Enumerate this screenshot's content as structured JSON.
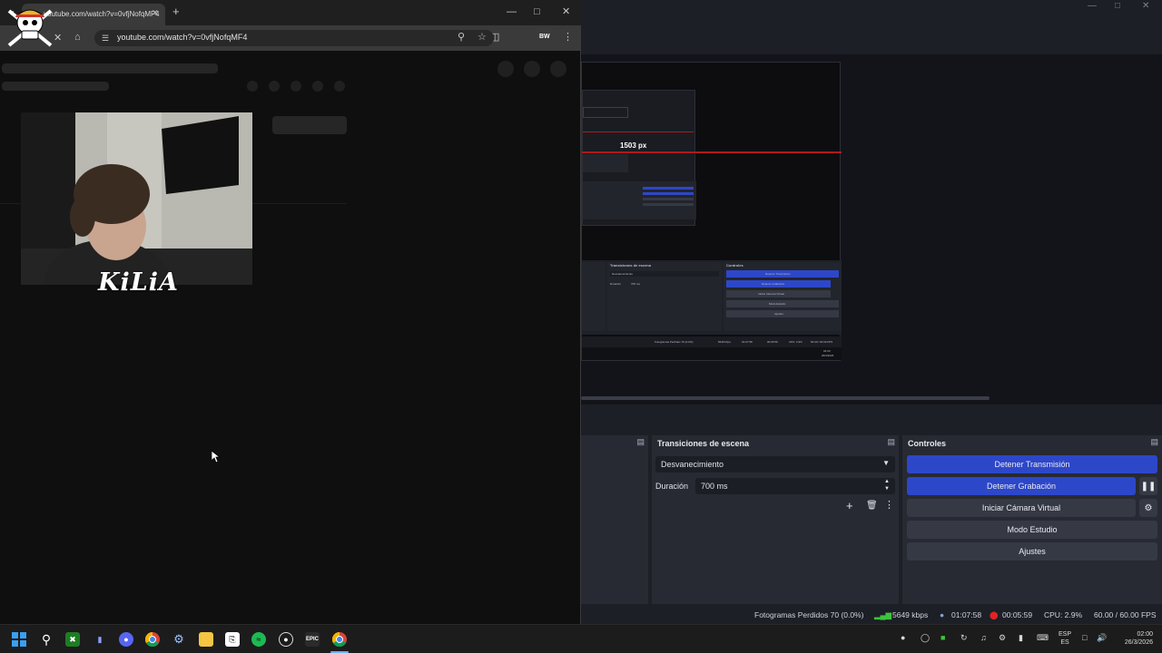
{
  "browser": {
    "tab_title": "youtube.com/watch?v=0vfjNofqMF4",
    "url": "youtube.com/watch?v=0vfjNofqMF4",
    "extension_badge": "BW",
    "overlay_text": "KiLiA"
  },
  "obs": {
    "preview": {
      "measure_label": "1503 px",
      "mini_labels": [
        "Transiciones de escena",
        "Controles",
        "Desvanecimiento",
        "Duración",
        "700 ms",
        "Detener Transmisión",
        "Detener Grabación",
        "Iniciar Cámara Virtual",
        "Modo Estudio",
        "Ajustes",
        "Fotogramas Perdidos 70 (0.0%)",
        "5649 kbps",
        "01:07:58",
        "00:05:59",
        "CPU: 2.9%",
        "60.00 / 60.00 FPS",
        "02:00",
        "26/3/2026"
      ]
    },
    "transitions": {
      "title": "Transiciones de escena",
      "selected": "Desvanecimiento",
      "duration_label": "Duración",
      "duration_value": "700 ms"
    },
    "controls": {
      "title": "Controles",
      "stop_stream": "Detener Transmisión",
      "stop_recording": "Detener Grabación",
      "start_virtual_cam": "Iniciar Cámara Virtual",
      "studio_mode": "Modo Estudio",
      "settings": "Ajustes"
    },
    "status": {
      "dropped_frames": "Fotogramas Perdidos 70 (0.0%)",
      "bitrate": "5649 kbps",
      "stream_time": "01:07:58",
      "record_time": "00:05:59",
      "cpu": "CPU: 2.9%",
      "fps": "60.00 / 60.00 FPS"
    },
    "colors": {
      "accent": "#2d47c9",
      "record": "#e02424",
      "signal": "#3cc43c"
    }
  },
  "taskbar": {
    "language_top": "ESP",
    "language_bottom": "ES",
    "time": "02:00",
    "date": "26/3/2026",
    "icons": [
      "windows-start-icon",
      "search-icon",
      "xbox-app-icon",
      "app-icon",
      "discord-icon",
      "chrome-icon",
      "steam-icon",
      "file-explorer-icon",
      "capcut-icon",
      "spotify-icon",
      "obs-icon",
      "epic-games-icon",
      "chrome-active-icon"
    ]
  }
}
